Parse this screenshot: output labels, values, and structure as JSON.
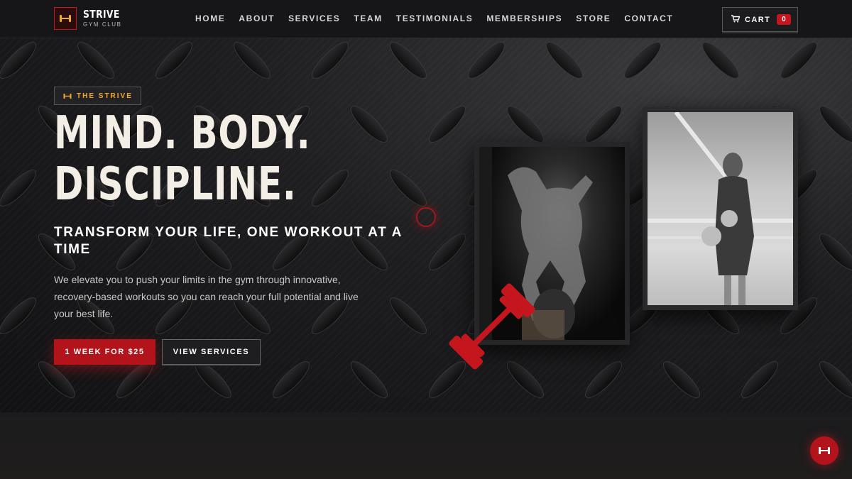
{
  "brand": {
    "name": "STRIVE",
    "subtitle": "GYM CLUB",
    "icon": "dumbbell-icon"
  },
  "nav": {
    "items": [
      "HOME",
      "ABOUT",
      "SERVICES",
      "TEAM",
      "TESTIMONIALS",
      "MEMBERSHIPS",
      "STORE",
      "CONTACT"
    ]
  },
  "cart": {
    "label": "CART",
    "count": "0",
    "icon": "cart-icon"
  },
  "hero": {
    "tag": "THE STRIVE",
    "headline_line1": "MIND. BODY.",
    "headline_line2": "DISCIPLINE.",
    "subheadline": "TRANSFORM YOUR LIFE, ONE WORKOUT AT A TIME",
    "description": "We elevate you to push your limits in the gym through innovative, recovery-based workouts so you can reach your full potential and live your best life.",
    "cta_primary": "1 WEEK FOR $25",
    "cta_secondary": "VIEW SERVICES"
  },
  "colors": {
    "accent": "#c4161c",
    "tag_text": "#f0a92a",
    "background": "#141416",
    "headline": "#f3efe6"
  }
}
